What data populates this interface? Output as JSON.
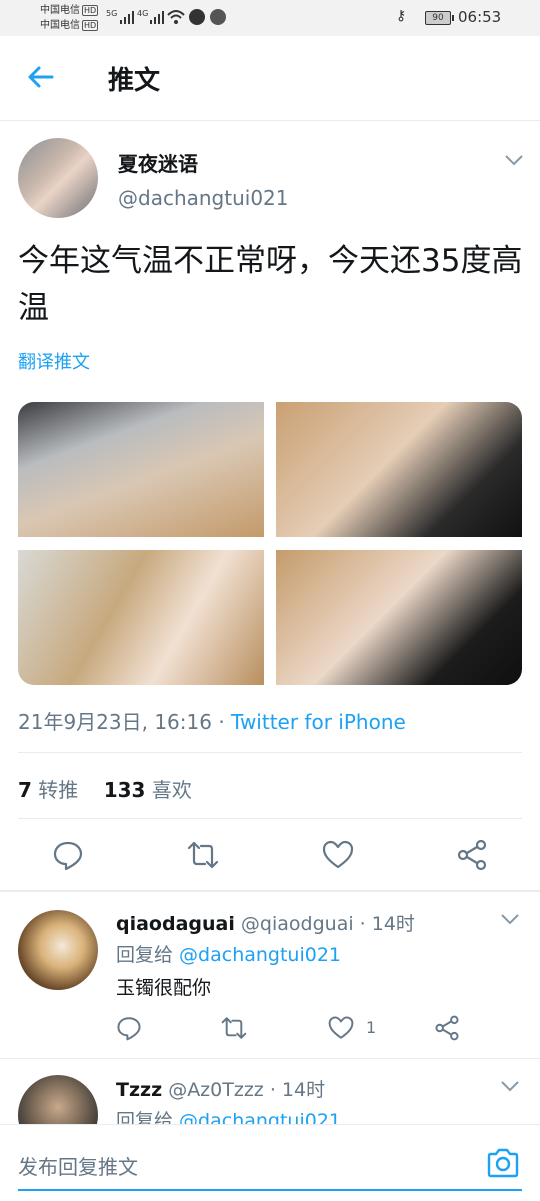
{
  "status_bar": {
    "carrier1": "中国电信",
    "carrier2": "中国电信",
    "hd": "HD",
    "net1": "5G",
    "net2": "4G",
    "battery": "90",
    "time": "06:53"
  },
  "header": {
    "title": "推文"
  },
  "tweet": {
    "name": "夏夜迷语",
    "handle": "@dachangtui021",
    "text": "今年这气温不正常呀，今天还35度高温",
    "translate": "翻译推文",
    "timestamp": "21年9月23日, 16:16 · ",
    "source": "Twitter for iPhone",
    "retweets": "7",
    "retweets_label": "转推",
    "likes": "133",
    "likes_label": "喜欢"
  },
  "replies": [
    {
      "name": "qiaodaguai",
      "handle": "@qiaodguai",
      "time": "· 14时",
      "replying_label": "回复给 ",
      "replying_to": "@dachangtui021",
      "text": "玉镯很配你",
      "like_count": "1"
    },
    {
      "name": "Tzzz",
      "handle": "@Az0Tzzz",
      "time": "· 14时",
      "replying_label": "回复给 ",
      "replying_to": "@dachangtui021"
    }
  ],
  "composer": {
    "placeholder": "发布回复推文"
  },
  "colors": {
    "accent": "#1da1f2",
    "secondary_text": "#657786",
    "divider": "#e6ecf0"
  },
  "icons": [
    "back-arrow-icon",
    "chevron-down-icon",
    "reply-icon",
    "retweet-icon",
    "like-icon",
    "share-icon",
    "camera-icon"
  ]
}
